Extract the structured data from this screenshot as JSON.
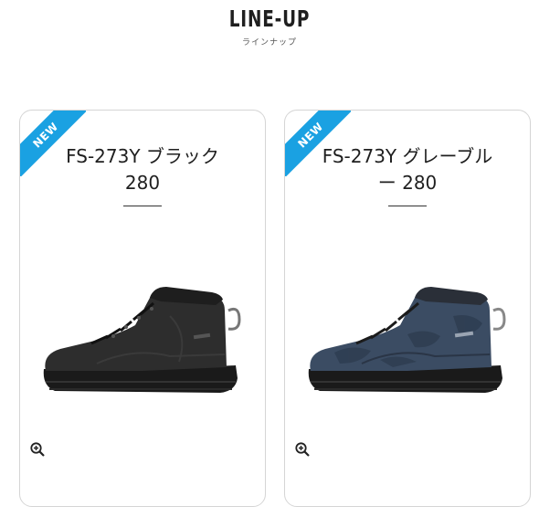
{
  "header": {
    "title": "LINE-UP",
    "subtitle": "ラインナップ"
  },
  "products": [
    {
      "badge": "NEW",
      "name_line1": "FS-273Y ブラック",
      "name_line2": "280",
      "color": "#2b2b2b",
      "zoom_icon": "zoom-in-icon"
    },
    {
      "badge": "NEW",
      "name_line1": "FS-273Y グレーブル",
      "name_line2": "ー 280",
      "color": "#3b4c63",
      "zoom_icon": "zoom-in-icon"
    }
  ],
  "accent_color": "#1aa1e2"
}
